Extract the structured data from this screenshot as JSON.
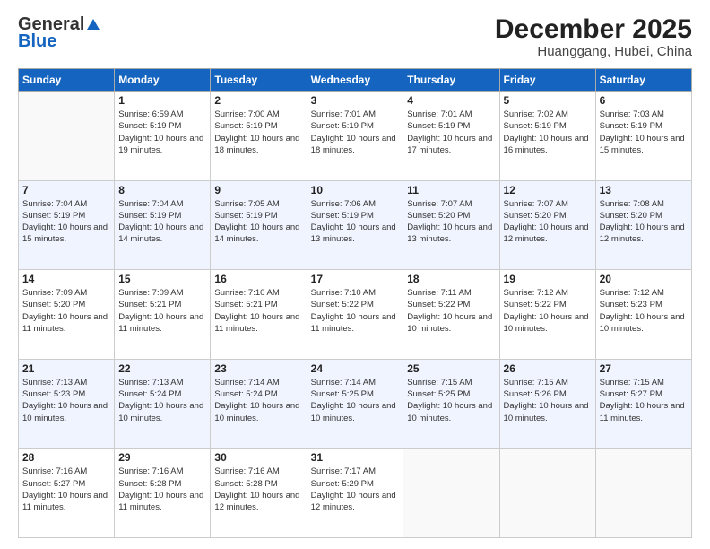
{
  "header": {
    "logo_general": "General",
    "logo_blue": "Blue",
    "month_title": "December 2025",
    "location": "Huanggang, Hubei, China"
  },
  "days_of_week": [
    "Sunday",
    "Monday",
    "Tuesday",
    "Wednesday",
    "Thursday",
    "Friday",
    "Saturday"
  ],
  "weeks": [
    [
      {
        "day": "",
        "sunrise": "",
        "sunset": "",
        "daylight": "",
        "empty": true
      },
      {
        "day": "1",
        "sunrise": "Sunrise: 6:59 AM",
        "sunset": "Sunset: 5:19 PM",
        "daylight": "Daylight: 10 hours and 19 minutes."
      },
      {
        "day": "2",
        "sunrise": "Sunrise: 7:00 AM",
        "sunset": "Sunset: 5:19 PM",
        "daylight": "Daylight: 10 hours and 18 minutes."
      },
      {
        "day": "3",
        "sunrise": "Sunrise: 7:01 AM",
        "sunset": "Sunset: 5:19 PM",
        "daylight": "Daylight: 10 hours and 18 minutes."
      },
      {
        "day": "4",
        "sunrise": "Sunrise: 7:01 AM",
        "sunset": "Sunset: 5:19 PM",
        "daylight": "Daylight: 10 hours and 17 minutes."
      },
      {
        "day": "5",
        "sunrise": "Sunrise: 7:02 AM",
        "sunset": "Sunset: 5:19 PM",
        "daylight": "Daylight: 10 hours and 16 minutes."
      },
      {
        "day": "6",
        "sunrise": "Sunrise: 7:03 AM",
        "sunset": "Sunset: 5:19 PM",
        "daylight": "Daylight: 10 hours and 15 minutes."
      }
    ],
    [
      {
        "day": "7",
        "sunrise": "Sunrise: 7:04 AM",
        "sunset": "Sunset: 5:19 PM",
        "daylight": "Daylight: 10 hours and 15 minutes."
      },
      {
        "day": "8",
        "sunrise": "Sunrise: 7:04 AM",
        "sunset": "Sunset: 5:19 PM",
        "daylight": "Daylight: 10 hours and 14 minutes."
      },
      {
        "day": "9",
        "sunrise": "Sunrise: 7:05 AM",
        "sunset": "Sunset: 5:19 PM",
        "daylight": "Daylight: 10 hours and 14 minutes."
      },
      {
        "day": "10",
        "sunrise": "Sunrise: 7:06 AM",
        "sunset": "Sunset: 5:19 PM",
        "daylight": "Daylight: 10 hours and 13 minutes."
      },
      {
        "day": "11",
        "sunrise": "Sunrise: 7:07 AM",
        "sunset": "Sunset: 5:20 PM",
        "daylight": "Daylight: 10 hours and 13 minutes."
      },
      {
        "day": "12",
        "sunrise": "Sunrise: 7:07 AM",
        "sunset": "Sunset: 5:20 PM",
        "daylight": "Daylight: 10 hours and 12 minutes."
      },
      {
        "day": "13",
        "sunrise": "Sunrise: 7:08 AM",
        "sunset": "Sunset: 5:20 PM",
        "daylight": "Daylight: 10 hours and 12 minutes."
      }
    ],
    [
      {
        "day": "14",
        "sunrise": "Sunrise: 7:09 AM",
        "sunset": "Sunset: 5:20 PM",
        "daylight": "Daylight: 10 hours and 11 minutes."
      },
      {
        "day": "15",
        "sunrise": "Sunrise: 7:09 AM",
        "sunset": "Sunset: 5:21 PM",
        "daylight": "Daylight: 10 hours and 11 minutes."
      },
      {
        "day": "16",
        "sunrise": "Sunrise: 7:10 AM",
        "sunset": "Sunset: 5:21 PM",
        "daylight": "Daylight: 10 hours and 11 minutes."
      },
      {
        "day": "17",
        "sunrise": "Sunrise: 7:10 AM",
        "sunset": "Sunset: 5:22 PM",
        "daylight": "Daylight: 10 hours and 11 minutes."
      },
      {
        "day": "18",
        "sunrise": "Sunrise: 7:11 AM",
        "sunset": "Sunset: 5:22 PM",
        "daylight": "Daylight: 10 hours and 10 minutes."
      },
      {
        "day": "19",
        "sunrise": "Sunrise: 7:12 AM",
        "sunset": "Sunset: 5:22 PM",
        "daylight": "Daylight: 10 hours and 10 minutes."
      },
      {
        "day": "20",
        "sunrise": "Sunrise: 7:12 AM",
        "sunset": "Sunset: 5:23 PM",
        "daylight": "Daylight: 10 hours and 10 minutes."
      }
    ],
    [
      {
        "day": "21",
        "sunrise": "Sunrise: 7:13 AM",
        "sunset": "Sunset: 5:23 PM",
        "daylight": "Daylight: 10 hours and 10 minutes."
      },
      {
        "day": "22",
        "sunrise": "Sunrise: 7:13 AM",
        "sunset": "Sunset: 5:24 PM",
        "daylight": "Daylight: 10 hours and 10 minutes."
      },
      {
        "day": "23",
        "sunrise": "Sunrise: 7:14 AM",
        "sunset": "Sunset: 5:24 PM",
        "daylight": "Daylight: 10 hours and 10 minutes."
      },
      {
        "day": "24",
        "sunrise": "Sunrise: 7:14 AM",
        "sunset": "Sunset: 5:25 PM",
        "daylight": "Daylight: 10 hours and 10 minutes."
      },
      {
        "day": "25",
        "sunrise": "Sunrise: 7:15 AM",
        "sunset": "Sunset: 5:25 PM",
        "daylight": "Daylight: 10 hours and 10 minutes."
      },
      {
        "day": "26",
        "sunrise": "Sunrise: 7:15 AM",
        "sunset": "Sunset: 5:26 PM",
        "daylight": "Daylight: 10 hours and 10 minutes."
      },
      {
        "day": "27",
        "sunrise": "Sunrise: 7:15 AM",
        "sunset": "Sunset: 5:27 PM",
        "daylight": "Daylight: 10 hours and 11 minutes."
      }
    ],
    [
      {
        "day": "28",
        "sunrise": "Sunrise: 7:16 AM",
        "sunset": "Sunset: 5:27 PM",
        "daylight": "Daylight: 10 hours and 11 minutes."
      },
      {
        "day": "29",
        "sunrise": "Sunrise: 7:16 AM",
        "sunset": "Sunset: 5:28 PM",
        "daylight": "Daylight: 10 hours and 11 minutes."
      },
      {
        "day": "30",
        "sunrise": "Sunrise: 7:16 AM",
        "sunset": "Sunset: 5:28 PM",
        "daylight": "Daylight: 10 hours and 12 minutes."
      },
      {
        "day": "31",
        "sunrise": "Sunrise: 7:17 AM",
        "sunset": "Sunset: 5:29 PM",
        "daylight": "Daylight: 10 hours and 12 minutes."
      },
      {
        "day": "",
        "sunrise": "",
        "sunset": "",
        "daylight": "",
        "empty": true
      },
      {
        "day": "",
        "sunrise": "",
        "sunset": "",
        "daylight": "",
        "empty": true
      },
      {
        "day": "",
        "sunrise": "",
        "sunset": "",
        "daylight": "",
        "empty": true
      }
    ]
  ]
}
